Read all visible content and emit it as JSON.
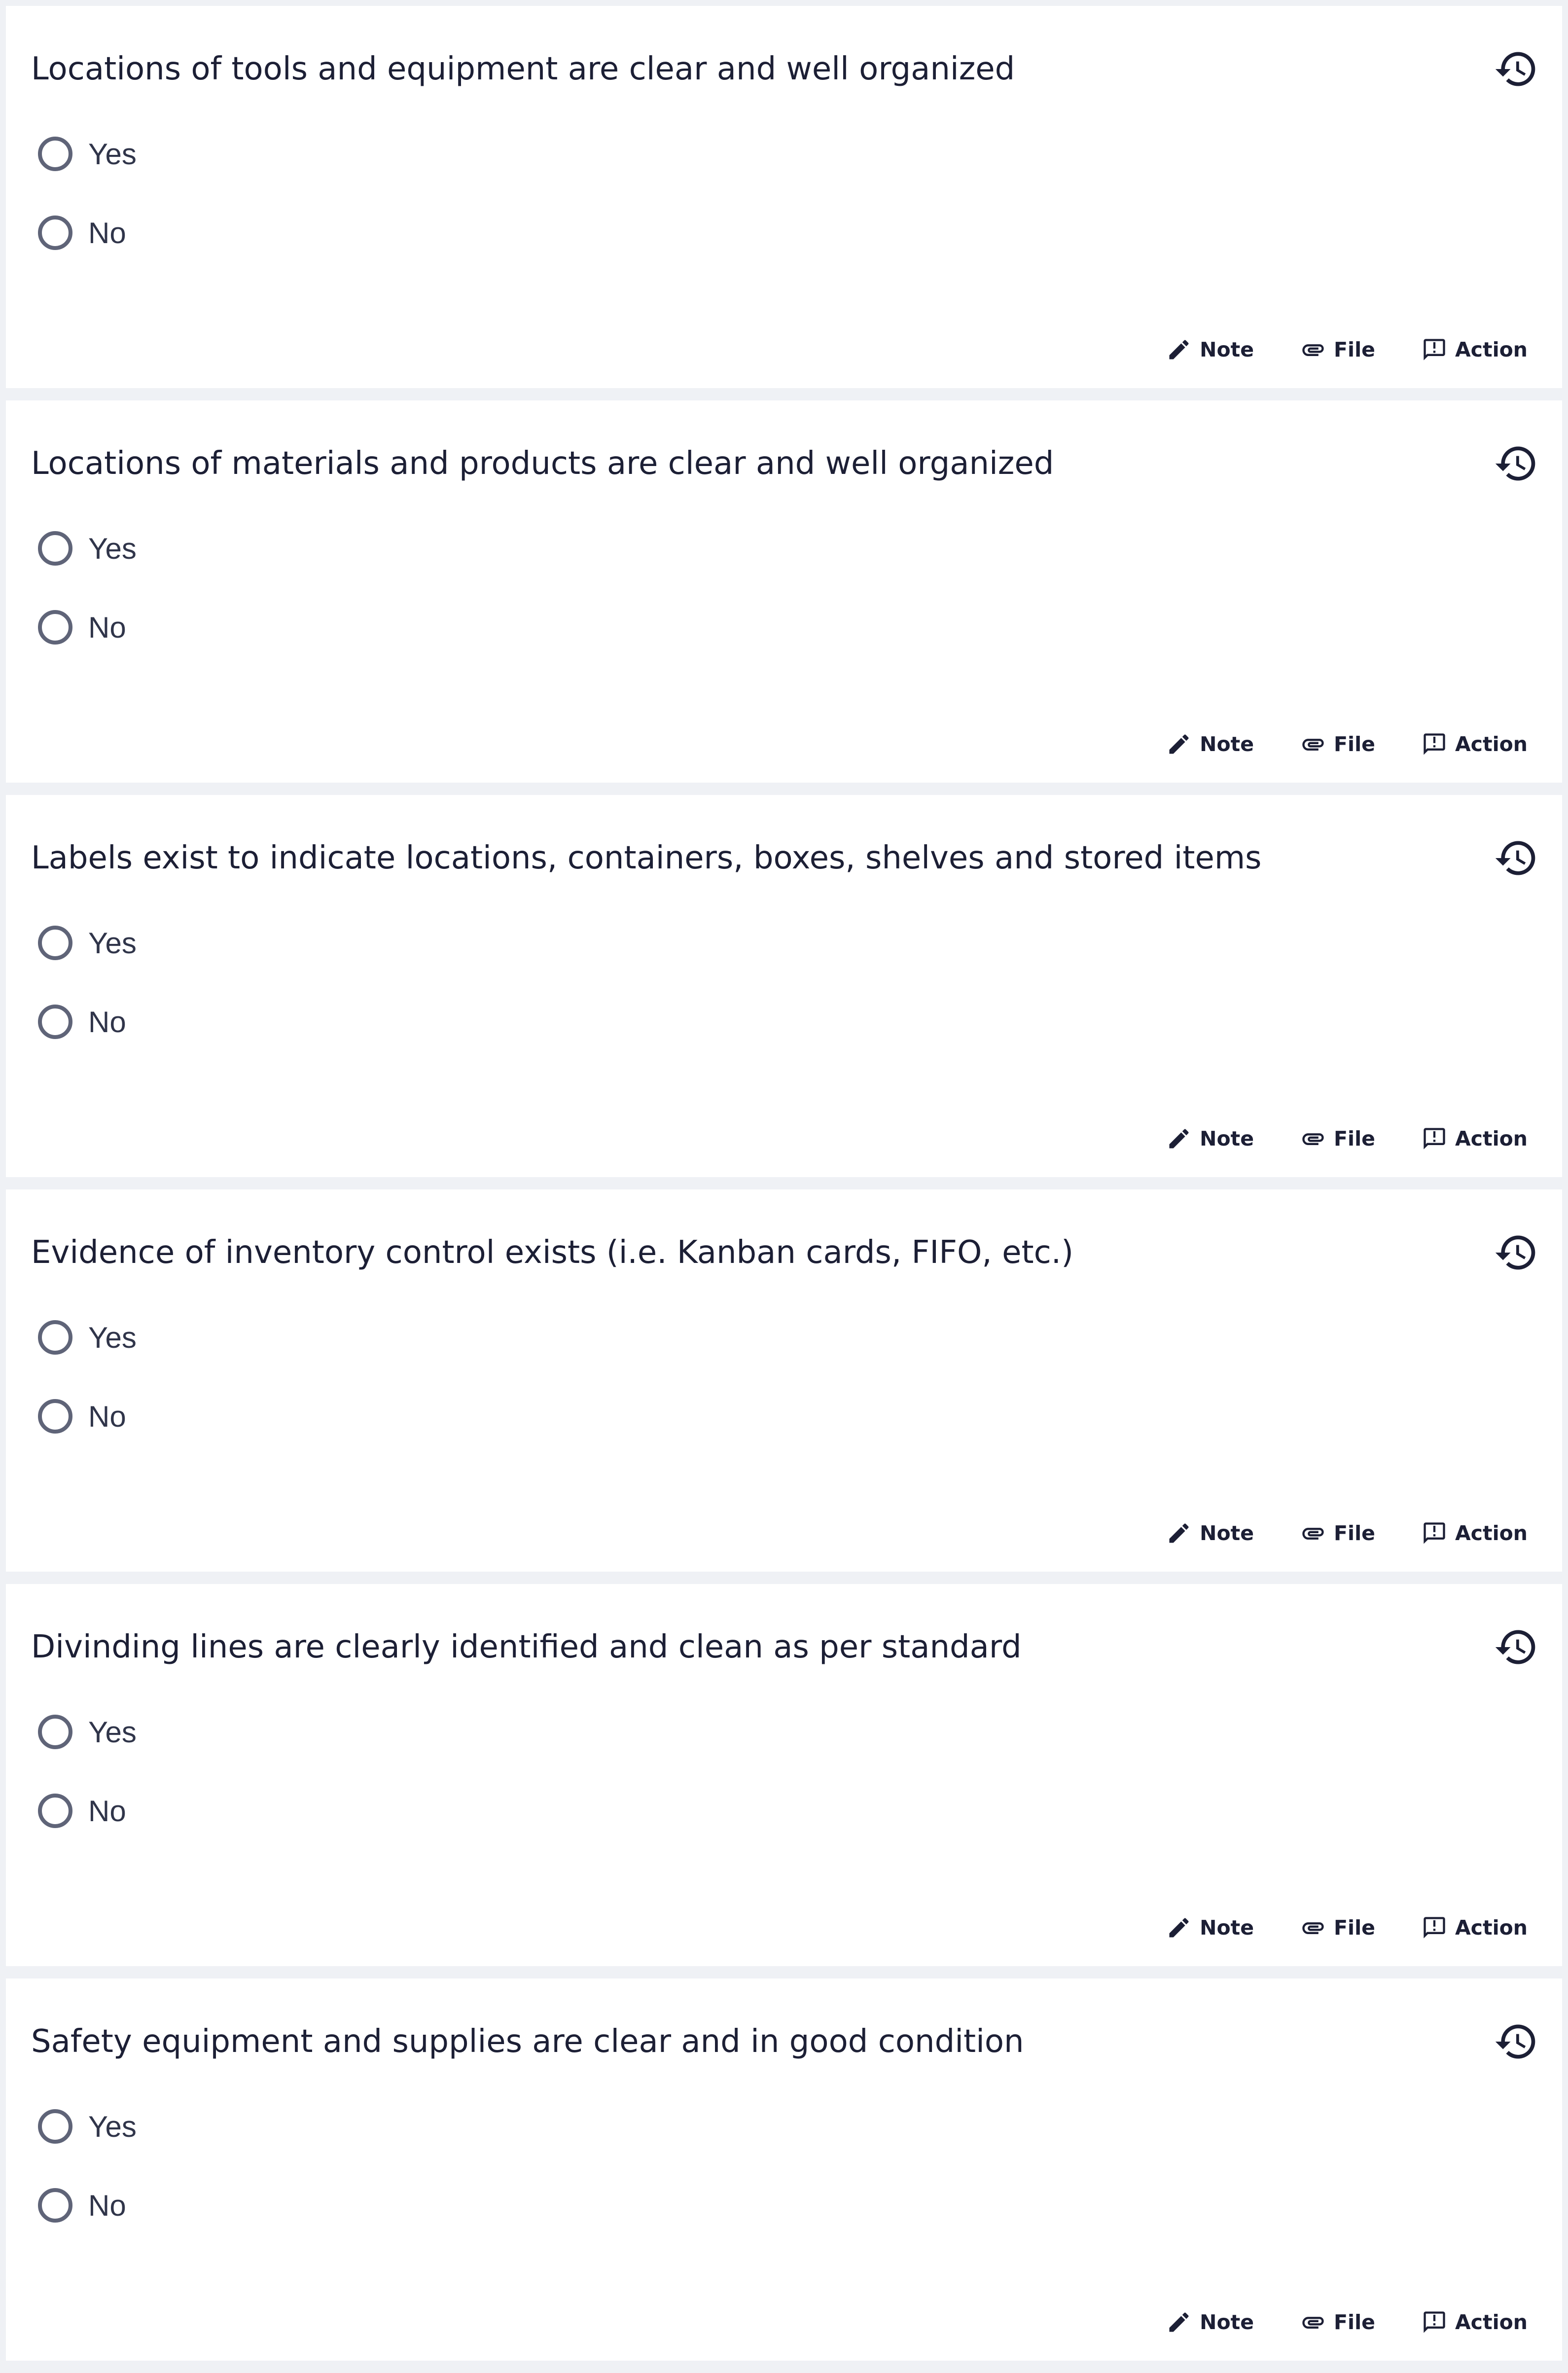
{
  "colors": {
    "page_background": "#eff1f5",
    "card_background": "#ffffff",
    "text": "#1c1f35",
    "radio_border": "#5f6478"
  },
  "icons": {
    "history": "history-icon",
    "note": "pencil-icon",
    "file": "paperclip-icon",
    "action": "feedback-icon"
  },
  "questions": [
    {
      "text": "Locations of tools and equipment are clear and well organized",
      "options": [
        "Yes",
        "No"
      ],
      "selected": null,
      "actions": {
        "note": "Note",
        "file": "File",
        "action": "Action"
      }
    },
    {
      "text": "Locations of materials and products are clear and well organized",
      "options": [
        "Yes",
        "No"
      ],
      "selected": null,
      "actions": {
        "note": "Note",
        "file": "File",
        "action": "Action"
      }
    },
    {
      "text": "Labels exist to indicate locations, containers, boxes, shelves and stored items",
      "options": [
        "Yes",
        "No"
      ],
      "selected": null,
      "actions": {
        "note": "Note",
        "file": "File",
        "action": "Action"
      }
    },
    {
      "text": "Evidence of inventory control exists (i.e. Kanban cards, FIFO, etc.)",
      "options": [
        "Yes",
        "No"
      ],
      "selected": null,
      "actions": {
        "note": "Note",
        "file": "File",
        "action": "Action"
      }
    },
    {
      "text": "Divinding lines are clearly identified and clean as per standard",
      "options": [
        "Yes",
        "No"
      ],
      "selected": null,
      "actions": {
        "note": "Note",
        "file": "File",
        "action": "Action"
      }
    },
    {
      "text": "Safety equipment and supplies are clear and in good condition",
      "options": [
        "Yes",
        "No"
      ],
      "selected": null,
      "actions": {
        "note": "Note",
        "file": "File",
        "action": "Action"
      }
    }
  ]
}
